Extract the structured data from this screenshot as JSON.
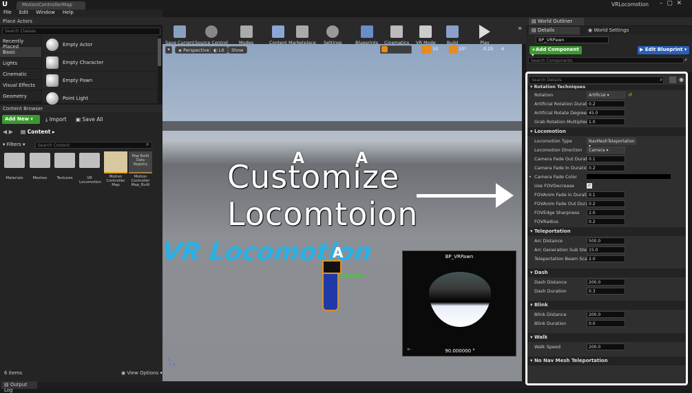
{
  "app": {
    "tab_title": "MotionControllerMap",
    "project": "VRLocomotion"
  },
  "menu": [
    "File",
    "Edit",
    "Window",
    "Help"
  ],
  "place_actors": {
    "title": "Place Actors",
    "search_placeholder": "Search Classes",
    "categories": [
      "Recently Placed",
      "Basic",
      "Lights",
      "Cinematic",
      "Visual Effects",
      "Geometry"
    ],
    "items": [
      "Empty Actor",
      "Empty Character",
      "Empty Pawn",
      "Point Light"
    ]
  },
  "toolbar": {
    "buttons": [
      "Save Current",
      "Source Control",
      "Modes",
      "Content",
      "Marketplace",
      "Settings",
      "Blueprints",
      "Cinematics",
      "VR Mode",
      "Build",
      "Play"
    ]
  },
  "content_browser": {
    "title": "Content Browser",
    "add_new": "Add New",
    "import": "Import",
    "save_all": "Save All",
    "path": "Content",
    "filters": "Filters",
    "search_placeholder": "Search Content",
    "assets": [
      "Materials",
      "Meshes",
      "Textures",
      "VR Locomotion",
      "Motion Controller Map",
      "Motion Controller Map_Built"
    ],
    "map_build_thumb": "Map Build Data Registry",
    "count": "6 items",
    "view_options": "View Options"
  },
  "output_log": "Output Log",
  "viewport": {
    "perspective": "Perspective",
    "lit": "Lit",
    "show": "Show",
    "grid_snap": "10",
    "rot_snap": "10°",
    "scale_snap": "0.25",
    "cam_speed": "4",
    "floor_text": "VR Locomotion",
    "overlay_line1": "Customize",
    "overlay_line2": "Locomtoion"
  },
  "preview": {
    "title": "BP_VRPawn",
    "value": "90.000000 °"
  },
  "world_outliner": {
    "title": "World Outliner"
  },
  "details": {
    "tab_details": "Details",
    "tab_world_settings": "World Settings",
    "actor_name": "BP_VRPawn",
    "add_component": "+Add Component",
    "edit_blueprint": "Edit Blueprint",
    "search_components": "Search Components",
    "search_details": "Search Details"
  },
  "props": {
    "rot_header": "Rotation Techniques",
    "rotation": {
      "label": "Rotation",
      "value": "Artificial"
    },
    "ard": {
      "label": "Artificial Rotation Duration",
      "value": "0.2"
    },
    "ardeg": {
      "label": "Artificial Rotate Degrees",
      "value": "45.0"
    },
    "grm": {
      "label": "Grab Rotation Multiplier",
      "value": "1.0"
    },
    "loco_header": "Locomotion",
    "ltype": {
      "label": "Locomotion Type",
      "value": "NavMeshTeleportation"
    },
    "ldir": {
      "label": "Locomotion Direction",
      "value": "Camera"
    },
    "cfo": {
      "label": "Camera Fade Out Duration",
      "value": "0.1"
    },
    "cfi": {
      "label": "Camera Fade In Duration",
      "value": "0.2"
    },
    "cfc": {
      "label": "Camera Fade Color"
    },
    "ufov": {
      "label": "Use FOVDecrease"
    },
    "fai": {
      "label": "FOVAnim Fade in Duration",
      "value": "0.1"
    },
    "fao": {
      "label": "FOVAnim Fade Out Duration",
      "value": "0.2"
    },
    "fes": {
      "label": "FOVEdge Sharpness",
      "value": "2.0"
    },
    "fr": {
      "label": "FOVRadius",
      "value": "0.2"
    },
    "tele_header": "Teleportation",
    "ad": {
      "label": "Arc Distance",
      "value": "500.0"
    },
    "agss": {
      "label": "Arc Generation Sub Step",
      "value": "15.0"
    },
    "tbs": {
      "label": "Teleportation Beam Scale",
      "value": "2.0"
    },
    "dash_header": "Dash",
    "dd": {
      "label": "Dash Distance",
      "value": "200.0"
    },
    "ddur": {
      "label": "Dash Duration",
      "value": "0.3"
    },
    "blink_header": "Blink",
    "bd": {
      "label": "Blink Distance",
      "value": "200.0"
    },
    "bdur": {
      "label": "Blink Duration",
      "value": "0.0"
    },
    "walk_header": "Walk",
    "ws": {
      "label": "Walk Speed",
      "value": "200.0"
    },
    "nonav_header": "No Nav Mesh Teleportation"
  },
  "colors": {
    "accent_green": "#3a9a2e",
    "accent_blue": "#2a5fb8",
    "floor_text": "#2ab0e6"
  }
}
